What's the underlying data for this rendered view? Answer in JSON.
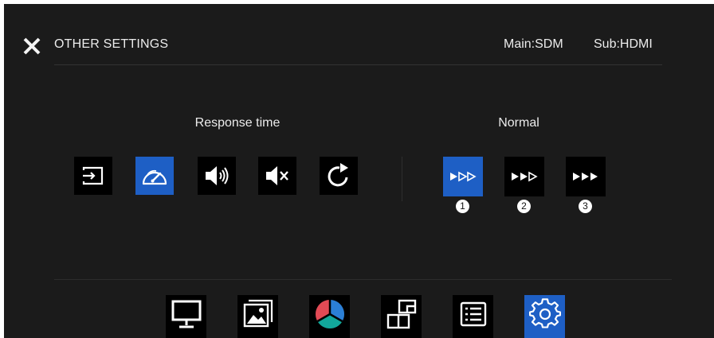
{
  "header": {
    "title": "OTHER SETTINGS",
    "source_main": "Main:SDM",
    "source_sub": "Sub:HDMI"
  },
  "response_time": {
    "label": "Response time",
    "items": [
      {
        "icon": "input-icon",
        "selected": false
      },
      {
        "icon": "speedometer-icon",
        "selected": true
      },
      {
        "icon": "volume-icon",
        "selected": false
      },
      {
        "icon": "mute-icon",
        "selected": false
      },
      {
        "icon": "reset-icon",
        "selected": false
      }
    ]
  },
  "mode": {
    "label": "Normal",
    "options": [
      {
        "badge": "1",
        "icon": "fast-forward-normal-icon",
        "selected": true
      },
      {
        "badge": "2",
        "icon": "fast-forward-fast-icon",
        "selected": false
      },
      {
        "badge": "3",
        "icon": "fast-forward-fastest-icon",
        "selected": false
      }
    ]
  },
  "menu": {
    "items": [
      {
        "icon": "monitor-icon",
        "selected": false
      },
      {
        "icon": "picture-icon",
        "selected": false
      },
      {
        "icon": "color-icon",
        "selected": false
      },
      {
        "icon": "multi-window-icon",
        "selected": false
      },
      {
        "icon": "list-icon",
        "selected": false
      },
      {
        "icon": "gear-icon",
        "selected": true
      }
    ]
  },
  "colors": {
    "accent": "#1e5fc5",
    "background": "#1b1b1b",
    "tile": "#000000",
    "text": "#ececec"
  }
}
